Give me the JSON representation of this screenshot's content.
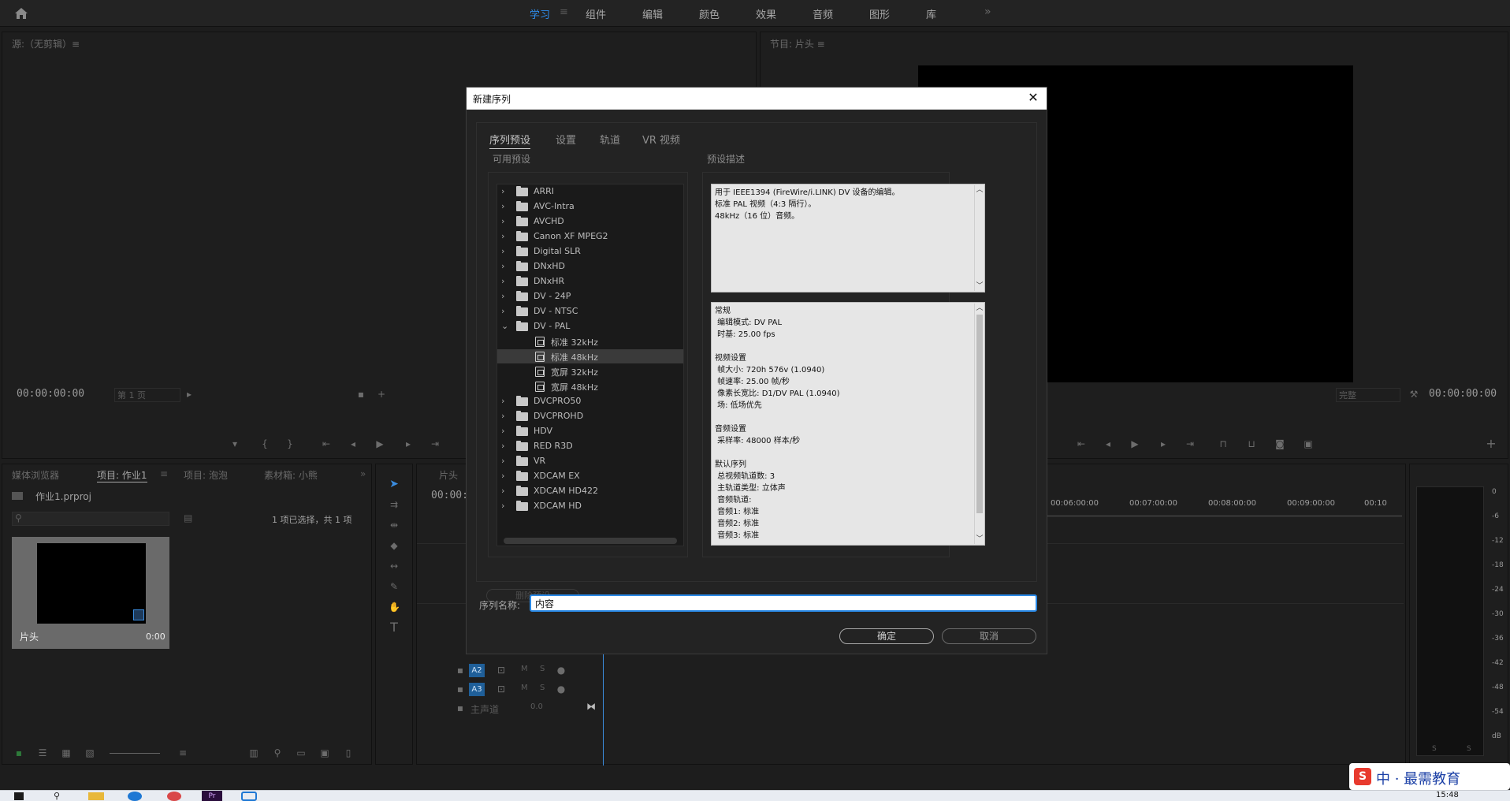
{
  "workspaces": {
    "home_icon": "home-icon",
    "tabs": [
      "学习",
      "组件",
      "编辑",
      "颜色",
      "效果",
      "音频",
      "图形",
      "库"
    ],
    "more": "»"
  },
  "source_panel": {
    "title": "源:（无剪辑）≡",
    "timecode": "00:00:00:00",
    "page": "第 1 页"
  },
  "program_panel": {
    "title": "节目: 片头 ≡",
    "zoom": "完整",
    "timecode": "00:00:00:00"
  },
  "project_panel": {
    "tabs": [
      "媒体浏览器",
      "项目: 作业1",
      "项目: 泡泡",
      "素材箱: 小熊"
    ],
    "file": "作业1.prproj",
    "selection_status": "1 项已选择，共 1 项",
    "clip_name": "片头",
    "clip_duration": "0:00"
  },
  "timeline": {
    "title": "片头",
    "timecode": "00:00:",
    "ruler": [
      "00:06:00:00",
      "00:07:00:00",
      "00:08:00:00",
      "00:09:00:00",
      "00:10"
    ],
    "tracks": [
      "A2",
      "A3"
    ],
    "track_m": "M",
    "track_s": "S",
    "master_label": "主声道",
    "master_value": "0.0"
  },
  "meter": {
    "ticks": [
      "0",
      "-6",
      "-12",
      "-18",
      "-24",
      "-30",
      "-36",
      "-42",
      "-48",
      "-54",
      "dB"
    ],
    "solo": [
      "S",
      "S"
    ]
  },
  "dialog": {
    "title": "新建序列",
    "close": "✕",
    "tabs": [
      "序列预设",
      "设置",
      "轨道",
      "VR 视频"
    ],
    "available_presets_label": "可用预设",
    "presets": [
      {
        "label": "ARRI",
        "type": "folder",
        "expanded": false
      },
      {
        "label": "AVC-Intra",
        "type": "folder",
        "expanded": false
      },
      {
        "label": "AVCHD",
        "type": "folder",
        "expanded": false
      },
      {
        "label": "Canon XF MPEG2",
        "type": "folder",
        "expanded": false
      },
      {
        "label": "Digital SLR",
        "type": "folder",
        "expanded": false
      },
      {
        "label": "DNxHD",
        "type": "folder",
        "expanded": false
      },
      {
        "label": "DNxHR",
        "type": "folder",
        "expanded": false
      },
      {
        "label": "DV - 24P",
        "type": "folder",
        "expanded": false
      },
      {
        "label": "DV - NTSC",
        "type": "folder",
        "expanded": false
      },
      {
        "label": "DV - PAL",
        "type": "folder",
        "expanded": true
      },
      {
        "label": "标准 32kHz",
        "type": "preset"
      },
      {
        "label": "标准 48kHz",
        "type": "preset",
        "selected": true
      },
      {
        "label": "宽屏 32kHz",
        "type": "preset"
      },
      {
        "label": "宽屏 48kHz",
        "type": "preset"
      },
      {
        "label": "DVCPRO50",
        "type": "folder",
        "expanded": false
      },
      {
        "label": "DVCPROHD",
        "type": "folder",
        "expanded": false
      },
      {
        "label": "HDV",
        "type": "folder",
        "expanded": false
      },
      {
        "label": "RED R3D",
        "type": "folder",
        "expanded": false
      },
      {
        "label": "VR",
        "type": "folder",
        "expanded": false
      },
      {
        "label": "XDCAM EX",
        "type": "folder",
        "expanded": false
      },
      {
        "label": "XDCAM HD422",
        "type": "folder",
        "expanded": false
      },
      {
        "label": "XDCAM HD",
        "type": "folder",
        "expanded": false
      }
    ],
    "preset_desc_label": "预设描述",
    "description": "用于 IEEE1394 (FireWire/i.LINK) DV 设备的编辑。\n标准 PAL 视频（4:3 隔行）。\n48kHz（16 位）音频。",
    "details": "常规\n 编辑模式: DV PAL\n 时基: 25.00 fps\n\n视频设置\n 帧大小: 720h 576v (1.0940)\n 帧速率: 25.00 帧/秒\n 像素长宽比: D1/DV PAL (1.0940)\n 场: 低场优先\n\n音频设置\n 采样率: 48000 样本/秒\n\n默认序列\n 总视频轨道数: 3\n 主轨道类型: 立体声\n 音频轨道:\n 音频1: 标准\n 音频2: 标准\n 音频3: 标准",
    "delete_preset": "删除预设",
    "sequence_name_label": "序列名称:",
    "sequence_name_value": "内容",
    "ok": "确定",
    "cancel": "取消"
  },
  "watermark": "中 · 最需教育",
  "clock": "15:48"
}
